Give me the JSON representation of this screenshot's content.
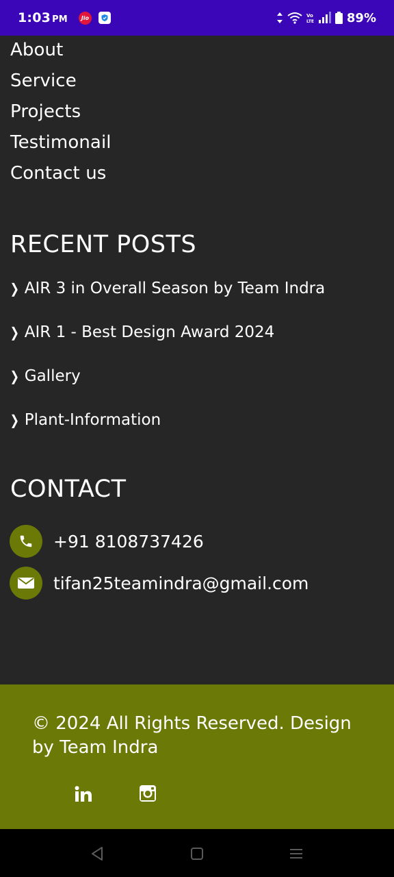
{
  "status_bar": {
    "time": "1:03",
    "ampm": "PM",
    "jio_label": "Jio",
    "battery": "89%",
    "icons": [
      "jio-icon",
      "shield-icon",
      "data-arrows-icon",
      "wifi-icon",
      "volte-icon",
      "signal-icon",
      "battery-icon"
    ]
  },
  "nav_links": [
    "About",
    "Service",
    "Projects",
    "Testimonail",
    "Contact us"
  ],
  "recent_posts": {
    "title": "RECENT POSTS",
    "chevron": "❯",
    "items": [
      "AIR 3 in Overall Season by Team Indra",
      "AIR 1 - Best Design Award 2024",
      "Gallery",
      "Plant-Information"
    ]
  },
  "contact": {
    "title": "CONTACT",
    "phone": "+91 8108737426",
    "email": "tifan25teamindra@gmail.com",
    "icons": [
      "phone-icon",
      "envelope-icon"
    ]
  },
  "footer": {
    "copyright": "© 2024 All Rights Reserved. Design by Team Indra",
    "social_icons": [
      "linkedin-icon",
      "instagram-icon"
    ]
  },
  "colors": {
    "status_bar": "#3a06b8",
    "background": "#262626",
    "accent_olive": "#6b7a06",
    "nav_bar": "#000000"
  }
}
